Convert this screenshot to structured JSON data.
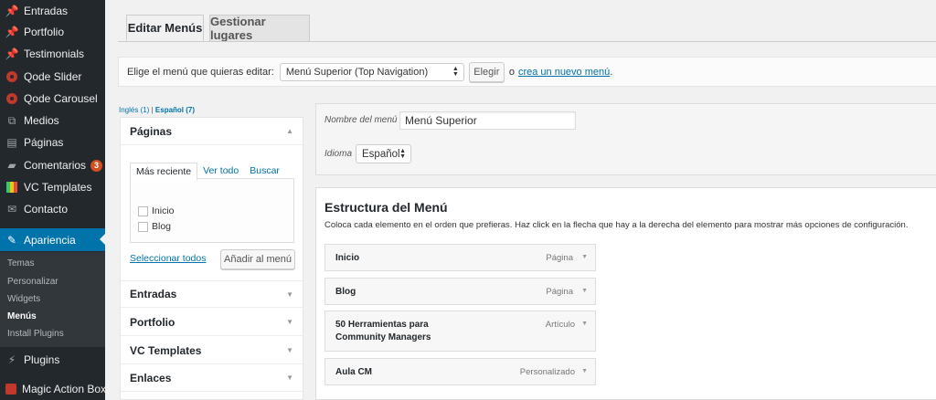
{
  "sidebar": {
    "items": [
      {
        "label": "Entradas",
        "icon": "pushpin-icon"
      },
      {
        "label": "Portfolio",
        "icon": "pushpin-icon"
      },
      {
        "label": "Testimonials",
        "icon": "pushpin-icon"
      },
      {
        "label": "Qode Slider",
        "icon": "qode-icon"
      },
      {
        "label": "Qode Carousel",
        "icon": "qode-icon"
      },
      {
        "label": "Medios",
        "icon": "media-icon"
      },
      {
        "label": "Páginas",
        "icon": "page-icon"
      },
      {
        "label": "Comentarios",
        "icon": "comment-icon",
        "badge": "3"
      },
      {
        "label": "VC Templates",
        "icon": "vc-icon"
      },
      {
        "label": "Contacto",
        "icon": "mail-icon"
      },
      {
        "label": "Apariencia",
        "icon": "brush-icon"
      },
      {
        "label": "Plugins",
        "icon": "plug-icon"
      },
      {
        "label": "Magic Action Box",
        "icon": "box-icon"
      }
    ],
    "submenu": [
      "Temas",
      "Personalizar",
      "Widgets",
      "Menús",
      "Install Plugins"
    ],
    "active_color": "#0073aa"
  },
  "tabs": {
    "edit": "Editar Menús",
    "manage": "Gestionar lugares"
  },
  "select_bar": {
    "prompt": "Elige el menú que quieras editar:",
    "selected_menu": "Menú Superior (Top Navigation)",
    "button": "Elegir",
    "or_text": "o",
    "create_link": "crea un nuevo menú",
    "trailing": "."
  },
  "languages": {
    "ingles": "Inglés (1)",
    "separator": "|",
    "espanol": "Español (7)"
  },
  "left_panel": {
    "pages_title": "Páginas",
    "pages_tabs": [
      "Más reciente",
      "Ver todo",
      "Buscar"
    ],
    "pages": [
      "Inicio",
      "Blog"
    ],
    "select_all": "Seleccionar todos",
    "add_button": "Añadir al menú",
    "sections": [
      "Entradas",
      "Portfolio",
      "VC Templates",
      "Enlaces"
    ]
  },
  "menu_settings": {
    "name_label": "Nombre del menú",
    "name_value": "Menú Superior",
    "language_label": "Idioma",
    "language_value": "Español"
  },
  "structure": {
    "title": "Estructura del Menú",
    "description": "Coloca cada elemento en el orden que prefieras. Haz click en la flecha que hay a la derecha del elemento para mostrar más opciones de configuración.",
    "items": [
      {
        "title": "Inicio",
        "type": "Página"
      },
      {
        "title": "Blog",
        "type": "Página"
      },
      {
        "title": "50 Herramientas para",
        "title2": "Community Managers",
        "type": "Artículo"
      },
      {
        "title": "Aula CM",
        "type": "Personalizado"
      }
    ]
  }
}
